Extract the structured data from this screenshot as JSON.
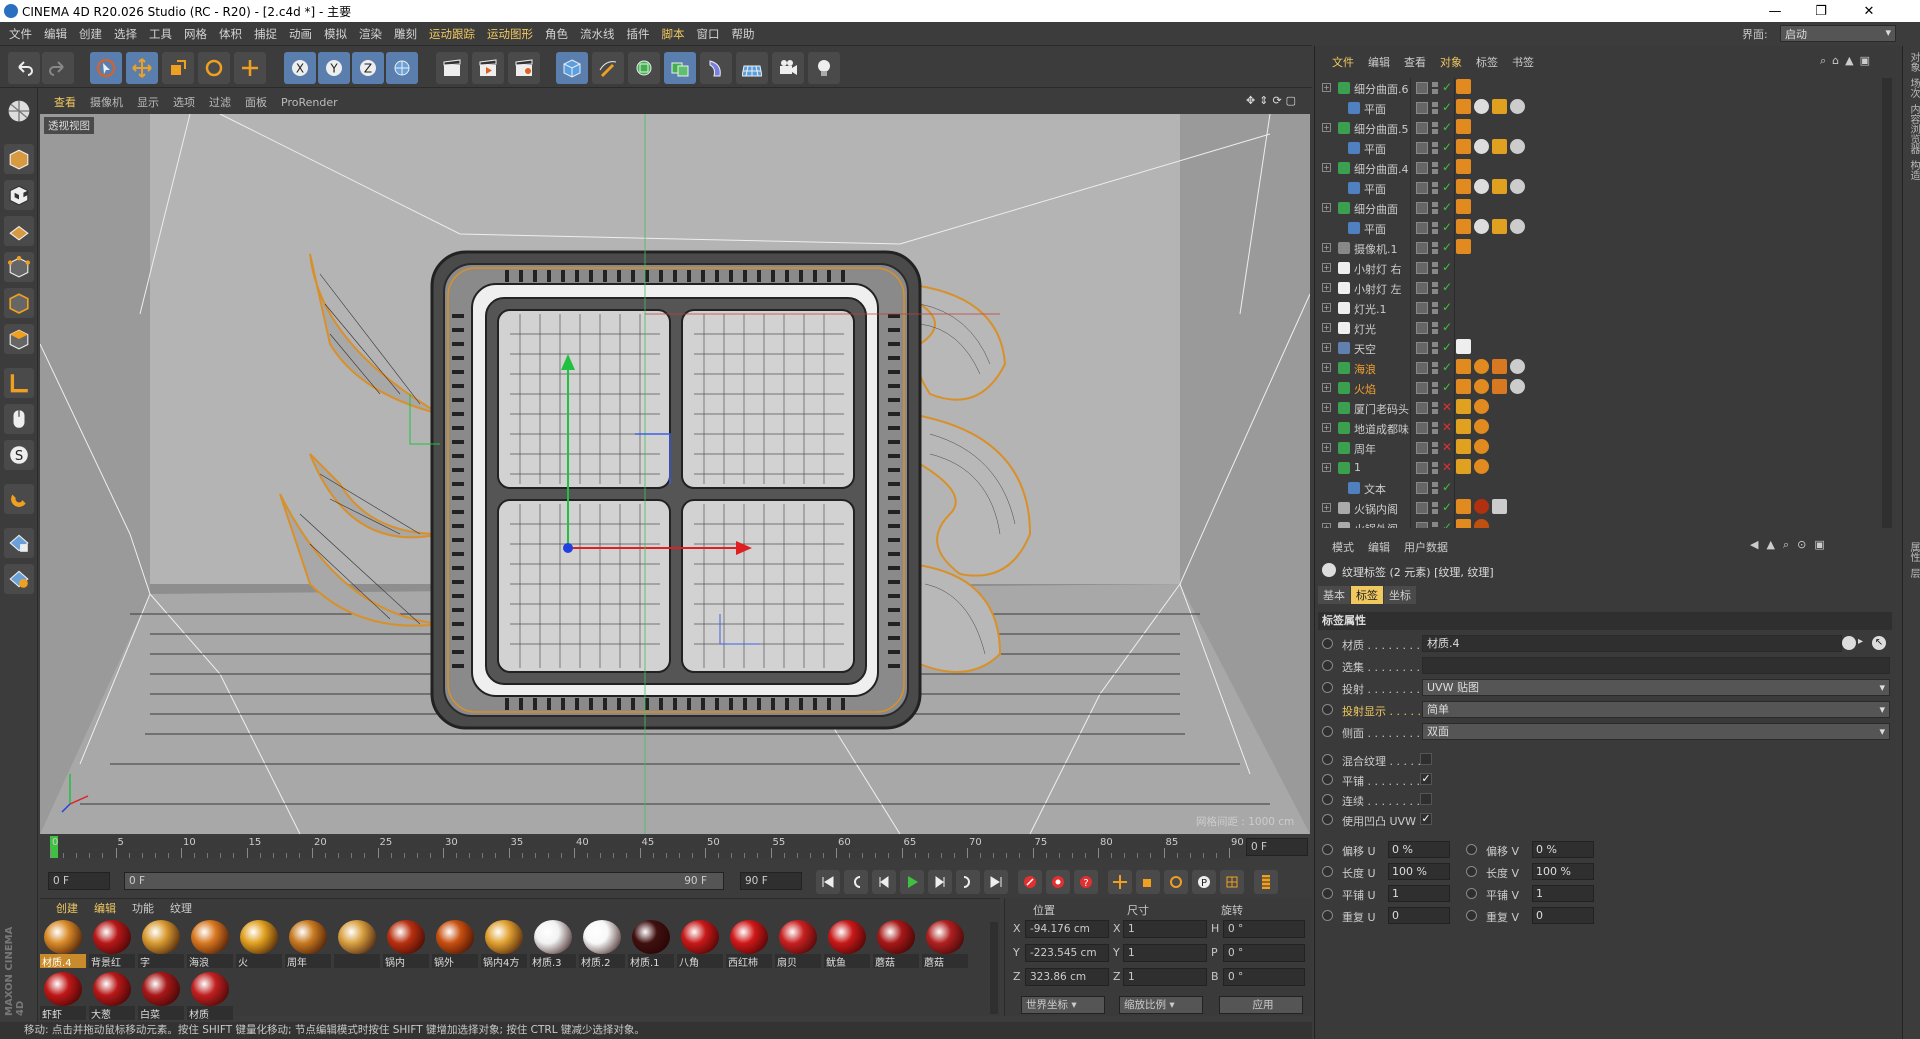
{
  "window": {
    "title": "CINEMA 4D R20.026 Studio (RC - R20) - [2.c4d *] - 主要"
  },
  "menu": [
    "文件",
    "编辑",
    "创建",
    "选择",
    "工具",
    "网格",
    "体积",
    "捕捉",
    "动画",
    "模拟",
    "渲染",
    "雕刻",
    "运动跟踪",
    "运动图形",
    "角色",
    "流水线",
    "插件",
    "脚本",
    "窗口",
    "帮助"
  ],
  "layout": {
    "label": "界面:",
    "value": "启动"
  },
  "viewport": {
    "menu": [
      "查看",
      "摄像机",
      "显示",
      "选项",
      "过滤",
      "面板",
      "ProRender"
    ],
    "label": "透视视图",
    "grid": "网格间距 : 1000 cm"
  },
  "timeline": {
    "ticks": [
      "0",
      "5",
      "10",
      "15",
      "20",
      "25",
      "30",
      "35",
      "40",
      "45",
      "50",
      "55",
      "60",
      "65",
      "70",
      "75",
      "80",
      "85",
      "90"
    ],
    "frame_end_field": "0 F",
    "start": "0 F",
    "range_start": "0 F",
    "range_end": "90 F",
    "end": "90 F"
  },
  "materials": {
    "tabs": [
      "创建",
      "编辑",
      "功能",
      "纹理"
    ],
    "items": [
      {
        "name": "材质.4",
        "color": "#d88a28",
        "sel": true
      },
      {
        "name": "背景红",
        "color": "#b81818"
      },
      {
        "name": "字",
        "color": "#d89a30"
      },
      {
        "name": "海浪",
        "color": "#d87820"
      },
      {
        "name": "火",
        "color": "#e0a020"
      },
      {
        "name": "周年",
        "color": "#c87a20"
      },
      {
        "name": "",
        "color": "#d8a040"
      },
      {
        "name": "锅内",
        "color": "#b83010"
      },
      {
        "name": "锅外",
        "color": "#c85010"
      },
      {
        "name": "锅内4方",
        "color": "#e0a030"
      },
      {
        "name": "材质.3",
        "color": "#f2f2f2"
      },
      {
        "name": "材质.2",
        "color": "#f8f8f8"
      },
      {
        "name": "材质.1",
        "color": "#401010"
      },
      {
        "name": "八角",
        "color": "#c81818"
      },
      {
        "name": "西红柿",
        "color": "#d01818"
      },
      {
        "name": "扇贝",
        "color": "#c82020"
      },
      {
        "name": "鱿鱼",
        "color": "#c81818"
      },
      {
        "name": "蘑菇",
        "color": "#a81818"
      },
      {
        "name": "蘑菇",
        "color": "#b02020"
      },
      {
        "name": "虾虾",
        "color": "#c01818"
      },
      {
        "name": "大葱",
        "color": "#b81818"
      },
      {
        "name": "白菜",
        "color": "#a81818"
      },
      {
        "name": "材质",
        "color": "#c02020"
      }
    ]
  },
  "coords": {
    "headers": [
      "位置",
      "尺寸",
      "旋转"
    ],
    "rows": [
      {
        "axis": "X",
        "pos": "-94.176 cm",
        "size": "1",
        "rot_axis": "H",
        "rot": "0 °"
      },
      {
        "axis": "Y",
        "pos": "-223.545 cm",
        "size": "1",
        "rot_axis": "P",
        "rot": "0 °"
      },
      {
        "axis": "Z",
        "pos": "323.86 cm",
        "size": "1",
        "rot_axis": "B",
        "rot": "0 °"
      }
    ],
    "mode1": "世界坐标",
    "mode2": "缩放比例",
    "apply": "应用"
  },
  "status": "移动: 点击并拖动鼠标移动元素。按住 SHIFT 键量化移动; 节点编辑模式时按住 SHIFT 键增加选择对象; 按住 CTRL 键减少选择对象。",
  "object_manager": {
    "menu": [
      "文件",
      "编辑",
      "查看",
      "对象",
      "标签",
      "书签"
    ],
    "rows": [
      {
        "name": "细分曲面.6",
        "indent": 0,
        "icon": "#3aa050",
        "tags": [
          "#e08a20"
        ]
      },
      {
        "name": "平面",
        "indent": 1,
        "icon": "#5080c0",
        "tags": [
          "#e08a20",
          "#ddd",
          "#e0a020",
          "#ccc"
        ]
      },
      {
        "name": "细分曲面.5",
        "indent": 0,
        "icon": "#3aa050",
        "tags": [
          "#e08a20"
        ]
      },
      {
        "name": "平面",
        "indent": 1,
        "icon": "#5080c0",
        "tags": [
          "#e08a20",
          "#ddd",
          "#e0a020",
          "#ccc"
        ]
      },
      {
        "name": "细分曲面.4",
        "indent": 0,
        "icon": "#3aa050",
        "tags": [
          "#e08a20"
        ]
      },
      {
        "name": "平面",
        "indent": 1,
        "icon": "#5080c0",
        "tags": [
          "#e08a20",
          "#ddd",
          "#e0a020",
          "#ccc"
        ]
      },
      {
        "name": "细分曲面",
        "indent": 0,
        "icon": "#3aa050",
        "tags": [
          "#e08a20"
        ]
      },
      {
        "name": "平面",
        "indent": 1,
        "icon": "#5080c0",
        "tags": [
          "#e08a20",
          "#ddd",
          "#e0a020",
          "#ccc"
        ]
      },
      {
        "name": "摄像机.1",
        "indent": 0,
        "icon": "#888",
        "tags": [
          "#e08a20"
        ]
      },
      {
        "name": "小射灯 右",
        "indent": 0,
        "icon": "#eee",
        "tags": []
      },
      {
        "name": "小射灯 左",
        "indent": 0,
        "icon": "#eee",
        "tags": []
      },
      {
        "name": "灯光.1",
        "indent": 0,
        "icon": "#eee",
        "tags": []
      },
      {
        "name": "灯光",
        "indent": 0,
        "icon": "#eee",
        "tags": []
      },
      {
        "name": "天空",
        "indent": 0,
        "icon": "#6080b0",
        "tags": [
          "#eee"
        ]
      },
      {
        "name": "海浪",
        "indent": 0,
        "icon": "#3aa050",
        "or": true,
        "tags": [
          "#e08a20",
          "#e08a20",
          "#d87820",
          "#ccc"
        ]
      },
      {
        "name": "火焰",
        "indent": 0,
        "icon": "#3aa050",
        "or": true,
        "tags": [
          "#e08a20",
          "#e08a20",
          "#d87820",
          "#ccc"
        ]
      },
      {
        "name": "厦门老码头",
        "indent": 0,
        "icon": "#3aa050",
        "tags": [
          "#e0a020",
          "#e08a20"
        ]
      },
      {
        "name": "地道成都味",
        "indent": 0,
        "icon": "#3aa050",
        "tags": [
          "#e0a020",
          "#e08a20"
        ]
      },
      {
        "name": "周年",
        "indent": 0,
        "icon": "#3aa050",
        "tags": [
          "#e0a020",
          "#e08a20"
        ]
      },
      {
        "name": "1",
        "indent": 0,
        "icon": "#3aa050",
        "tags": [
          "#e0a020",
          "#e08a20"
        ]
      },
      {
        "name": "文本",
        "indent": 1,
        "icon": "#5080c0",
        "tags": []
      },
      {
        "name": "火锅内阁",
        "indent": 0,
        "icon": "#aaa",
        "tags": [
          "#e08a20",
          "#b03010",
          "#ccc"
        ]
      },
      {
        "name": "火锅外阁",
        "indent": 0,
        "icon": "#aaa",
        "tags": [
          "#e08a20",
          "#c05010"
        ]
      }
    ]
  },
  "attr": {
    "menu": [
      "模式",
      "编辑",
      "用户数据"
    ],
    "title": "纹理标签 (2 元素) [纹理, 纹理]",
    "tabs": [
      "基本",
      "标签",
      "坐标"
    ],
    "section": "标签属性",
    "material_label": "材质 . . . . . . . .",
    "material_value": "材质.4",
    "selection_label": "选集 . . . . . . . .",
    "projection_label": "投射 . . . . . . . .",
    "projection_value": "UVW 贴图",
    "projdisp_label": "投射显示 . . . . .",
    "projdisp_value": "简单",
    "side_label": "侧面 . . . . . . . .",
    "side_value": "双面",
    "mix_label": "混合纹理 . . . . .",
    "tile_label": "平铺 . . . . . . . .",
    "seamless_label": "连续 . . . . . . . .",
    "uvw_bump_label": "使用凹凸 UVW",
    "checkmark": "✓",
    "offset_u": {
      "label": "偏移 U",
      "value": "0 %"
    },
    "offset_v": {
      "label": "偏移 V",
      "value": "0 %"
    },
    "length_u": {
      "label": "长度 U",
      "value": "100 %"
    },
    "length_v": {
      "label": "长度 V",
      "value": "100 %"
    },
    "tiles_u": {
      "label": "平铺 U",
      "value": "1"
    },
    "tiles_v": {
      "label": "平铺 V",
      "value": "1"
    },
    "repeat_u": {
      "label": "重复 U",
      "value": "0"
    },
    "repeat_v": {
      "label": "重复 V",
      "value": "0"
    }
  },
  "side_tabs": [
    "对象",
    "场次",
    "内容浏览器",
    "构造"
  ],
  "side_tabs2": [
    "属性",
    "层"
  ],
  "maxon": "MAXON CINEMA 4D"
}
